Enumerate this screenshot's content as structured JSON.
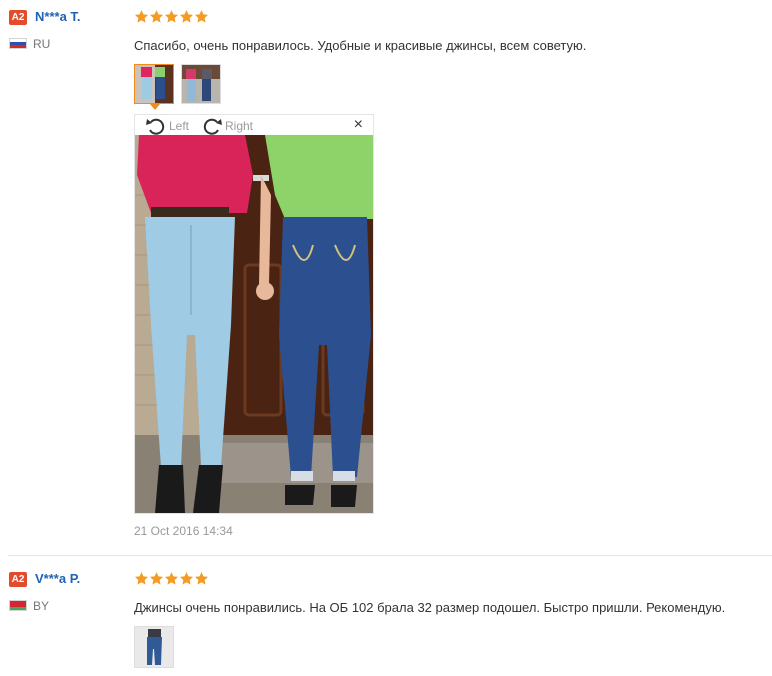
{
  "reviews": [
    {
      "badge": "A2",
      "name": "N***a T.",
      "country": "RU",
      "rating": 5,
      "text": "Спасибо, очень понравилось. Удобные и красивые джинсы, всем советую.",
      "viewer": {
        "rotate_left": "Left",
        "rotate_right": "Right",
        "close": "×"
      },
      "date": "21 Oct 2016 14:34"
    },
    {
      "badge": "A2",
      "name": "V***a P.",
      "country": "BY",
      "rating": 5,
      "text": "Джинсы очень понравились. На ОБ 102 брала 32 размер подошел. Быстро пришли. Рекомендую."
    }
  ],
  "colors": {
    "star": "#f59a23",
    "badge": "#e24c2c",
    "name": "#1f63b5",
    "active_thumb": "#f08c1c"
  }
}
